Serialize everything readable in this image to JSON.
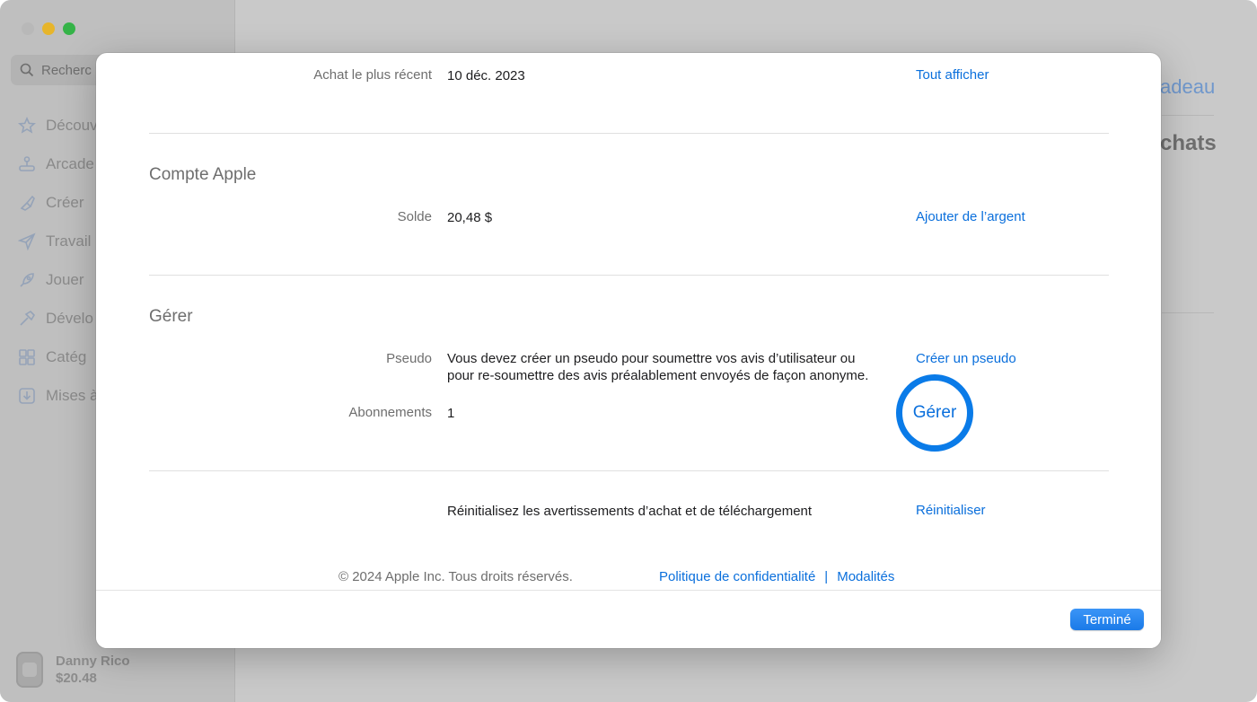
{
  "background": {
    "search_placeholder": "Recherc",
    "sidebar_items": [
      {
        "label": "Découv",
        "icon": "star-icon"
      },
      {
        "label": "Arcade",
        "icon": "joystick-icon"
      },
      {
        "label": "Créer",
        "icon": "brush-icon"
      },
      {
        "label": "Travail",
        "icon": "paperplane-icon"
      },
      {
        "label": "Jouer",
        "icon": "rocket-icon"
      },
      {
        "label": "Dévelo",
        "icon": "hammer-icon"
      },
      {
        "label": "Catég",
        "icon": "grid-icon"
      },
      {
        "label": "Mises à",
        "icon": "download-icon"
      }
    ],
    "user_name": "Danny Rico",
    "user_balance": "$20.48",
    "right_link": "adeau",
    "right_heading": "chats"
  },
  "sheet": {
    "recent_purchase": {
      "label": "Achat le plus récent",
      "value": "10 déc. 2023",
      "link": "Tout afficher"
    },
    "apple_account": {
      "title": "Compte Apple",
      "balance_label": "Solde",
      "balance_value": "20,48 $",
      "balance_link": "Ajouter de l’argent"
    },
    "manage": {
      "title": "Gérer",
      "nickname_label": "Pseudo",
      "nickname_text_line1": "Vous devez créer un pseudo pour soumettre vos avis d’utilisateur ou",
      "nickname_text_line2": "pour re-soumettre des avis préalablement envoyés de façon anonyme.",
      "nickname_link": "Créer un pseudo",
      "subscriptions_label": "Abonnements",
      "subscriptions_value": "1",
      "subscriptions_link": "Gérer"
    },
    "reset": {
      "text": "Réinitialisez les avertissements d’achat et de téléchargement",
      "link": "Réinitialiser"
    },
    "footer": {
      "copyright": "© 2024 Apple Inc. Tous droits réservés.",
      "privacy_link": "Politique de confidentialité",
      "separator": "|",
      "terms_link": "Modalités"
    },
    "done_button": "Terminé"
  },
  "colors": {
    "link": "#0a6fdc",
    "highlight_ring": "#0a7be8",
    "done_button": "#1a7ae8"
  }
}
